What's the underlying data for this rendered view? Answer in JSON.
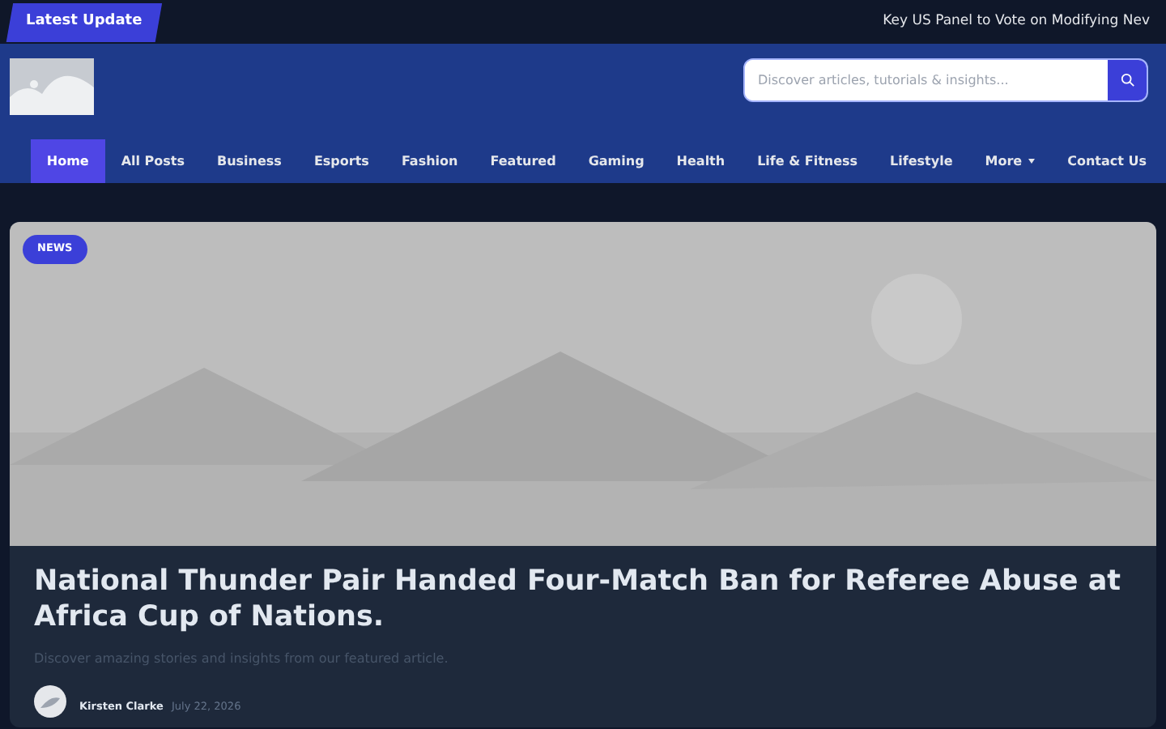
{
  "top_bar": {
    "label": "Latest Update",
    "ticker": "Key US Panel to Vote on Modifying Nev"
  },
  "header": {
    "search": {
      "placeholder": "Discover articles, tutorials & insights..."
    }
  },
  "nav": [
    {
      "label": "Home",
      "selected": true
    },
    {
      "label": "All Posts",
      "selected": false
    },
    {
      "label": "Business",
      "selected": false
    },
    {
      "label": "Esports",
      "selected": false
    },
    {
      "label": "Fashion",
      "selected": false
    },
    {
      "label": "Featured",
      "selected": false
    },
    {
      "label": "Gaming",
      "selected": false
    },
    {
      "label": "Health",
      "selected": false
    },
    {
      "label": "Life & Fitness",
      "selected": false
    },
    {
      "label": "Lifestyle",
      "selected": false
    },
    {
      "label": "More",
      "selected": false,
      "dropdown": true
    },
    {
      "label": "Contact Us",
      "selected": false
    }
  ],
  "featured": {
    "category": "NEWS",
    "title": "National Thunder Pair Handed Four-Match Ban for Referee Abuse at Africa Cup of Nations.",
    "excerpt": "Discover amazing stories and insights from our featured article.",
    "author": "Kirsten Clarke",
    "date": "July 22, 2026"
  }
}
